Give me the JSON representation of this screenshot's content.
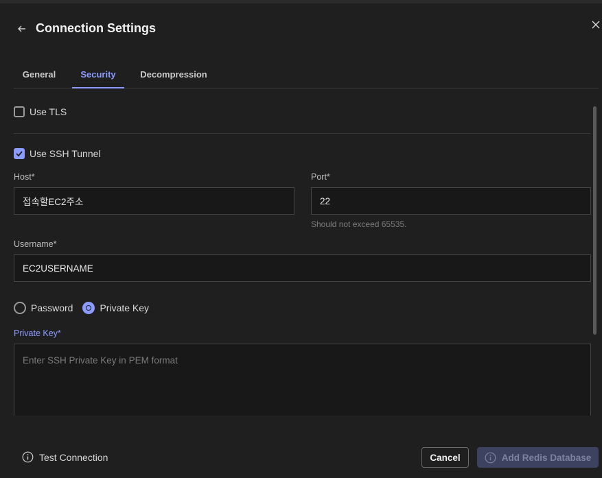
{
  "header": {
    "title": "Connection Settings"
  },
  "tabs": [
    {
      "label": "General"
    },
    {
      "label": "Security"
    },
    {
      "label": "Decompression"
    }
  ],
  "security": {
    "use_tls": {
      "label": "Use TLS",
      "checked": false
    },
    "use_ssh": {
      "label": "Use SSH Tunnel",
      "checked": true
    },
    "host": {
      "label": "Host*",
      "value": "접속할EC2주소"
    },
    "port": {
      "label": "Port*",
      "value": "22",
      "hint": "Should not exceed 65535."
    },
    "username": {
      "label": "Username*",
      "value": "EC2USERNAME"
    },
    "auth": {
      "options": [
        {
          "label": "Password",
          "selected": false
        },
        {
          "label": "Private Key",
          "selected": true
        }
      ]
    },
    "private_key": {
      "label": "Private Key*",
      "placeholder": "Enter SSH Private Key in PEM format",
      "value": ""
    }
  },
  "footer": {
    "test_connection": "Test Connection",
    "cancel": "Cancel",
    "add_database": "Add Redis Database"
  },
  "colors": {
    "accent": "#8c9bff",
    "background": "#1f1f1f",
    "input_background": "#181818"
  },
  "icons": [
    "arrow-left-icon",
    "close-icon",
    "check-icon",
    "info-icon"
  ]
}
